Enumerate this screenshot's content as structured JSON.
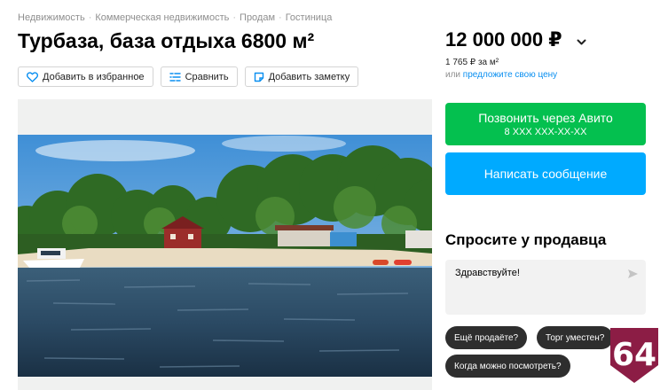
{
  "breadcrumbs": [
    "Недвижимость",
    "Коммерческая недвижимость",
    "Продам",
    "Гостиница"
  ],
  "title": "Турбаза, база отдыха 6800 м²",
  "actions": {
    "favorite": "Добавить в избранное",
    "compare": "Сравнить",
    "note": "Добавить заметку"
  },
  "price": {
    "value": "12 000 000 ₽",
    "per_m2": "1 765 ₽ за м²",
    "or": "или",
    "offer_link": "предложите свою цену"
  },
  "contact": {
    "call_label": "Позвонить через Авито",
    "call_phone": "8 XXX XXX-XX-XX",
    "message_label": "Написать сообщение"
  },
  "ask": {
    "title": "Спросите у продавца",
    "message_value": "Здравствуйте!",
    "quick_replies": [
      "Ещё продаёте?",
      "Торг уместен?",
      "Когда можно посмотреть?"
    ]
  },
  "badge": {
    "number": "64",
    "color": "#8c1d45"
  },
  "icons": [
    "heart-icon",
    "compare-icon",
    "note-icon",
    "chevron-down-icon",
    "send-icon"
  ],
  "colors": {
    "call": "#04c04f",
    "message": "#00aaff",
    "link": "#0a8ff0"
  }
}
